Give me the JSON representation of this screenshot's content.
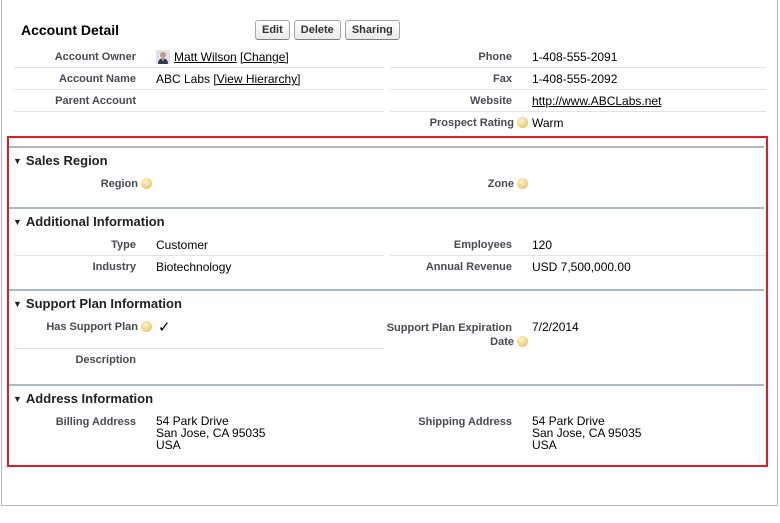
{
  "account_detail": {
    "title": "Account Detail",
    "buttons": {
      "edit": "Edit",
      "delete": "Delete",
      "sharing": "Sharing"
    },
    "account_owner_label": "Account Owner",
    "account_owner_value": "Matt Wilson",
    "account_owner_change": "[Change]",
    "phone_label": "Phone",
    "phone_value": "1-408-555-2091",
    "account_name_label": "Account Name",
    "account_name_value": "ABC Labs",
    "account_name_hierarchy": "[View Hierarchy]",
    "fax_label": "Fax",
    "fax_value": "1-408-555-2092",
    "parent_account_label": "Parent Account",
    "website_label": "Website",
    "website_value": "http://www.ABCLabs.net",
    "prospect_rating_label": "Prospect Rating",
    "prospect_rating_value": "Warm"
  },
  "sales_region": {
    "heading": "Sales Region",
    "region_label": "Region",
    "zone_label": "Zone"
  },
  "additional_info": {
    "heading": "Additional Information",
    "type_label": "Type",
    "type_value": "Customer",
    "employees_label": "Employees",
    "employees_value": "120",
    "industry_label": "Industry",
    "industry_value": "Biotechnology",
    "annual_revenue_label": "Annual Revenue",
    "annual_revenue_value": "USD 7,500,000.00"
  },
  "support_plan": {
    "heading": "Support Plan Information",
    "has_support_label": "Has Support Plan",
    "has_support_value": "✓",
    "expiration_label_line1": "Support Plan Expiration",
    "expiration_label_line2": "Date",
    "expiration_value": "7/2/2014",
    "description_label": "Description"
  },
  "address_info": {
    "heading": "Address Information",
    "billing_label": "Billing Address",
    "billing_line1": "54 Park Drive",
    "billing_line2": "San Jose, CA 95035",
    "billing_line3": "USA",
    "shipping_label": "Shipping Address",
    "shipping_line1": "54 Park Drive",
    "shipping_line2": "San Jose, CA 95035",
    "shipping_line3": "USA"
  },
  "colors": {
    "highlight_border": "#e51b24",
    "section_rule": "#adb8c6"
  }
}
